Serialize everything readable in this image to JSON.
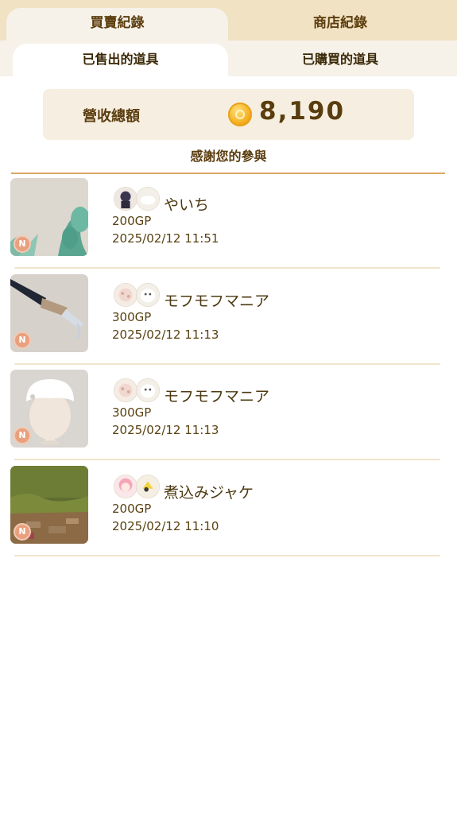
{
  "tabs": {
    "trade_history": "買賣紀錄",
    "shop_history": "商店紀錄"
  },
  "subtabs": {
    "sold_items": "已售出的道具",
    "bought_items": "已購買的道具"
  },
  "revenue": {
    "label": "營收總額",
    "icon": "gold-coin-icon",
    "value": "8,190"
  },
  "thanks": "感謝您的參與",
  "rarity_badge": "N",
  "items": [
    {
      "user": "やいち",
      "price": "200GP",
      "date": "2025/02/12 11:51",
      "thumb": "plant-wallpaper"
    },
    {
      "user": "モフモフマニア",
      "price": "300GP",
      "date": "2025/02/12 11:13",
      "thumb": "fountain-pen"
    },
    {
      "user": "モフモフマニア",
      "price": "300GP",
      "date": "2025/02/12 11:13",
      "thumb": "white-cap"
    },
    {
      "user": "煮込みジャケ",
      "price": "200GP",
      "date": "2025/02/12 11:10",
      "thumb": "garden-floor"
    }
  ]
}
